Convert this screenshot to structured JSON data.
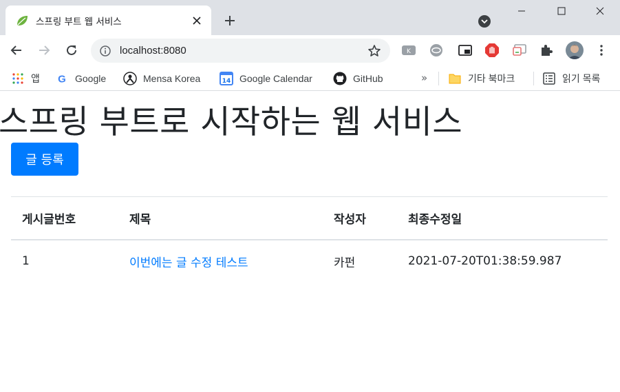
{
  "browser": {
    "tab": {
      "title": "스프링 부트 웹 서비스"
    },
    "address_bar": {
      "url": "localhost:8080"
    },
    "bookmarks": [
      {
        "label": "앱",
        "icon": "apps-grid-icon"
      },
      {
        "label": "Google",
        "icon": "google-icon"
      },
      {
        "label": "Mensa Korea",
        "icon": "mensa-icon"
      },
      {
        "label": "Google Calendar",
        "icon": "calendar-icon"
      },
      {
        "label": "GitHub",
        "icon": "github-icon"
      }
    ],
    "overflow_label": "»",
    "other_bookmarks": {
      "label": "기타 북마크",
      "icon": "folder-icon"
    },
    "reading_list": {
      "label": "읽기 목록",
      "icon": "reading-list-icon"
    },
    "calendar_badge": "14"
  },
  "page": {
    "title": "스프링 부트로 시작하는 웹 서비스",
    "register_button": "글 등록",
    "table": {
      "headers": [
        "게시글번호",
        "제목",
        "작성자",
        "최종수정일"
      ],
      "rows": [
        {
          "id": "1",
          "title": "이번에는 글 수정 테스트",
          "author": "카펀",
          "modified": "2021-07-20T01:38:59.987"
        }
      ]
    }
  },
  "colors": {
    "primary": "#007bff",
    "tabstrip": "#dee1e6",
    "text": "#212529"
  }
}
